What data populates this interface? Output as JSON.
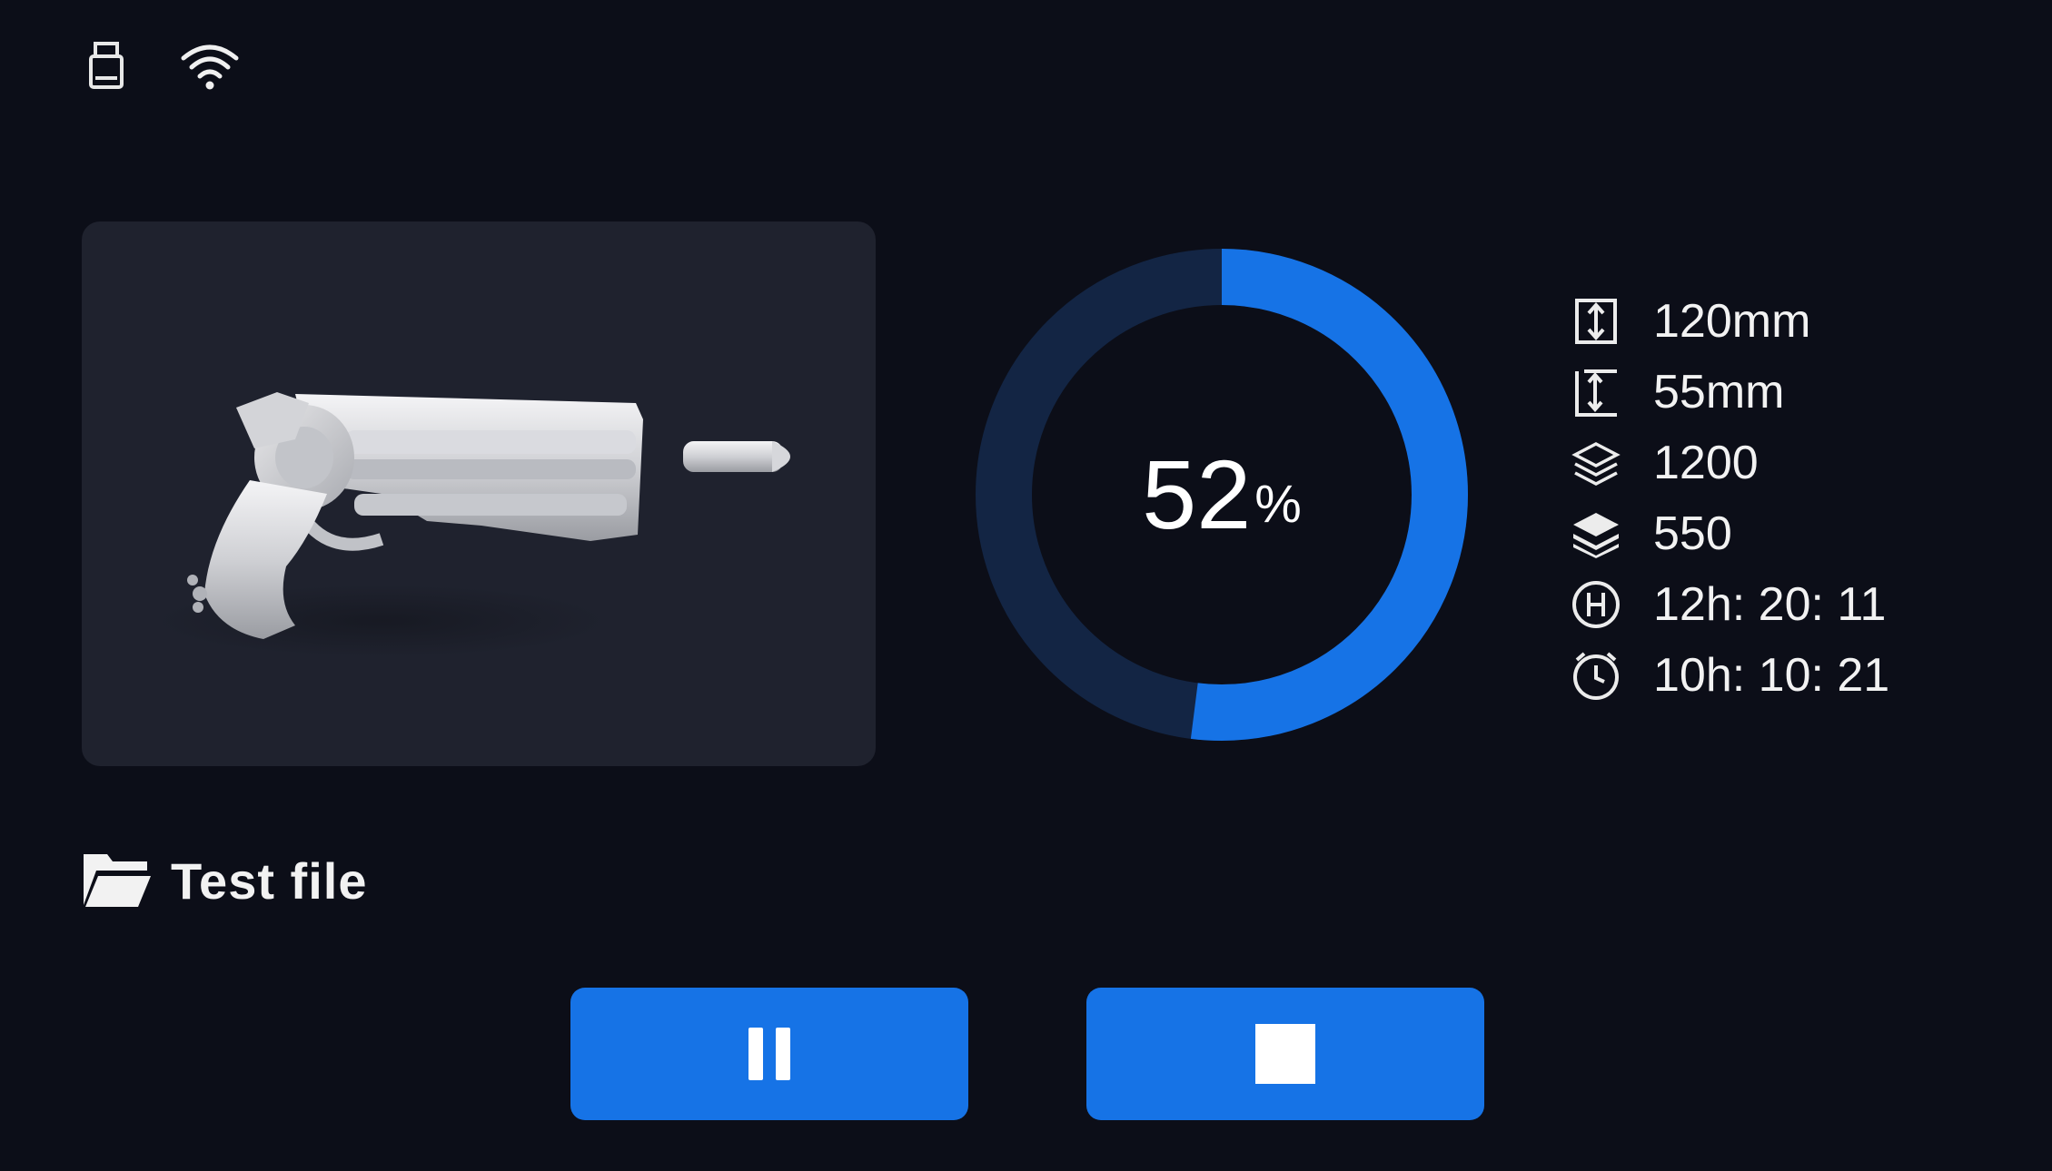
{
  "status_bar": {
    "icons": [
      "usb-icon",
      "wifi-icon"
    ]
  },
  "preview": {
    "image": "revolver-model-preview"
  },
  "file": {
    "icon": "folder-open-icon",
    "name": "Test file"
  },
  "progress": {
    "value": "52",
    "unit": "%",
    "fraction": 0.52,
    "colors": {
      "fill": "#1673e6",
      "track": "#132544"
    }
  },
  "stats": [
    {
      "icon": "model-height-icon",
      "value": "120mm"
    },
    {
      "icon": "printed-height-icon",
      "value": "55mm"
    },
    {
      "icon": "total-layers-icon",
      "value": "1200"
    },
    {
      "icon": "current-layer-icon",
      "value": "550"
    },
    {
      "icon": "total-time-icon",
      "value": "12h:  20:  11"
    },
    {
      "icon": "remaining-time-icon",
      "value": "10h:  10:  21"
    }
  ],
  "controls": {
    "pause": {
      "icon": "pause-icon"
    },
    "stop": {
      "icon": "stop-icon"
    },
    "accent": "#1673e6"
  }
}
